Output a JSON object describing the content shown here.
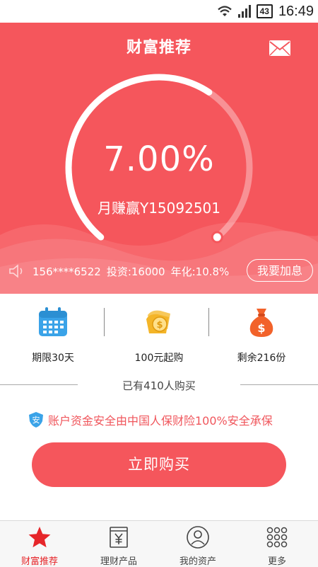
{
  "status_bar": {
    "battery": "43",
    "time": "16:49"
  },
  "header": {
    "title": "财富推荐"
  },
  "hero": {
    "rate": "7.00%",
    "earn": "月赚赢Y15092501",
    "dial_progress": 0.62,
    "info": {
      "phone": "156****6522",
      "invest": "投资:16000",
      "annual": "年化:10.8%"
    },
    "add_button": "我要加息"
  },
  "features": [
    {
      "icon": "calendar-icon",
      "label": "期限30天"
    },
    {
      "icon": "coin-icon",
      "label": "100元起购"
    },
    {
      "icon": "money-bag-icon",
      "label": "剩余216份"
    }
  ],
  "buyers_text": "已有410人购买",
  "security": {
    "badge": "安",
    "text": "账户资金安全由中国人保财险100%安全承保"
  },
  "buy_button": "立即购买",
  "bottom_nav": [
    {
      "icon": "star-icon",
      "label": "财富推荐",
      "active": true
    },
    {
      "icon": "yuan-document-icon",
      "label": "理财产品",
      "active": false
    },
    {
      "icon": "user-icon",
      "label": "我的资产",
      "active": false
    },
    {
      "icon": "grid-icon",
      "label": "更多",
      "active": false
    }
  ],
  "colors": {
    "accent": "#f5565c",
    "active_nav": "#e6262a",
    "icon_blue": "#3aa3e8",
    "icon_gold": "#f4b528",
    "icon_orange": "#f2622a"
  }
}
